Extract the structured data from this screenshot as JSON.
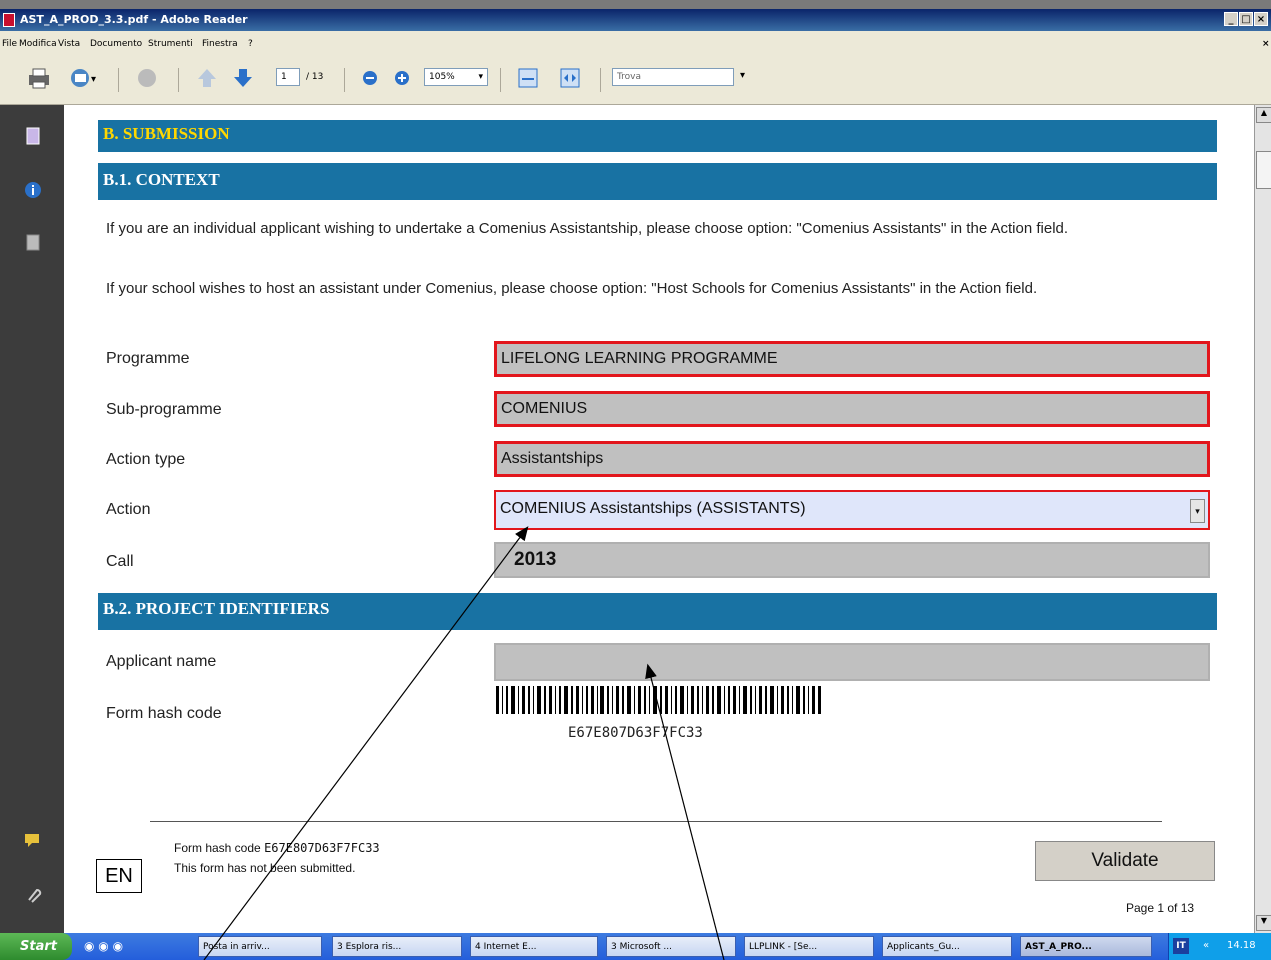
{
  "window": {
    "title": "AST_A_PROD_3.3.pdf - Adobe Reader",
    "min": "_",
    "max": "×"
  },
  "menu": [
    "File",
    "Modifica",
    "Vista",
    "Documento",
    "Strumenti",
    "Finestra",
    "?"
  ],
  "toolbar": {
    "page_current": "1",
    "page_total": "/ 13",
    "zoom": "105%",
    "search_placeholder": "Trova"
  },
  "form": {
    "section_b": "B. SUBMISSION",
    "section_b1": "B.1. CONTEXT",
    "para1": "If you are an individual applicant wishing to undertake a Comenius Assistantship, please choose option: \"Comenius Assistants\" in the Action field.",
    "para2": "If your school wishes to host an assistant under Comenius, please choose option: \"Host Schools for Comenius Assistants\" in the Action field.",
    "programme_label": "Programme",
    "programme_value": "LIFELONG LEARNING PROGRAMME",
    "subprogramme_label": "Sub-programme",
    "subprogramme_value": "COMENIUS",
    "action_type_label": "Action type",
    "action_type_value": "Assistantships",
    "action_label": "Action",
    "action_value": "COMENIUS Assistantships (ASSISTANTS)",
    "call_label": "Call",
    "call_value": "2013",
    "section_b2": "B.2. PROJECT IDENTIFIERS",
    "applicant_label": "Applicant name",
    "applicant_value": "",
    "hash_label": "Form hash code",
    "hash_value": "E67E807D63F7FC33"
  },
  "footer": {
    "lang": "EN",
    "hash_line_label": "Form hash code",
    "hash_line_value": "E67E807D63F7FC33",
    "status": "This form has not been submitted.",
    "validate_label": "Validate",
    "page_label": "Page 1 of 13"
  },
  "taskbar": {
    "start": "Start",
    "items": [
      "Posta in arriv...",
      "3 Esplora ris...",
      "4 Internet E...",
      "3 Microsoft ...",
      "LLPLINK - [Se...",
      "Applicants_Gu...",
      "AST_A_PRO..."
    ],
    "lang_badge": "IT",
    "clock": "14.18"
  }
}
